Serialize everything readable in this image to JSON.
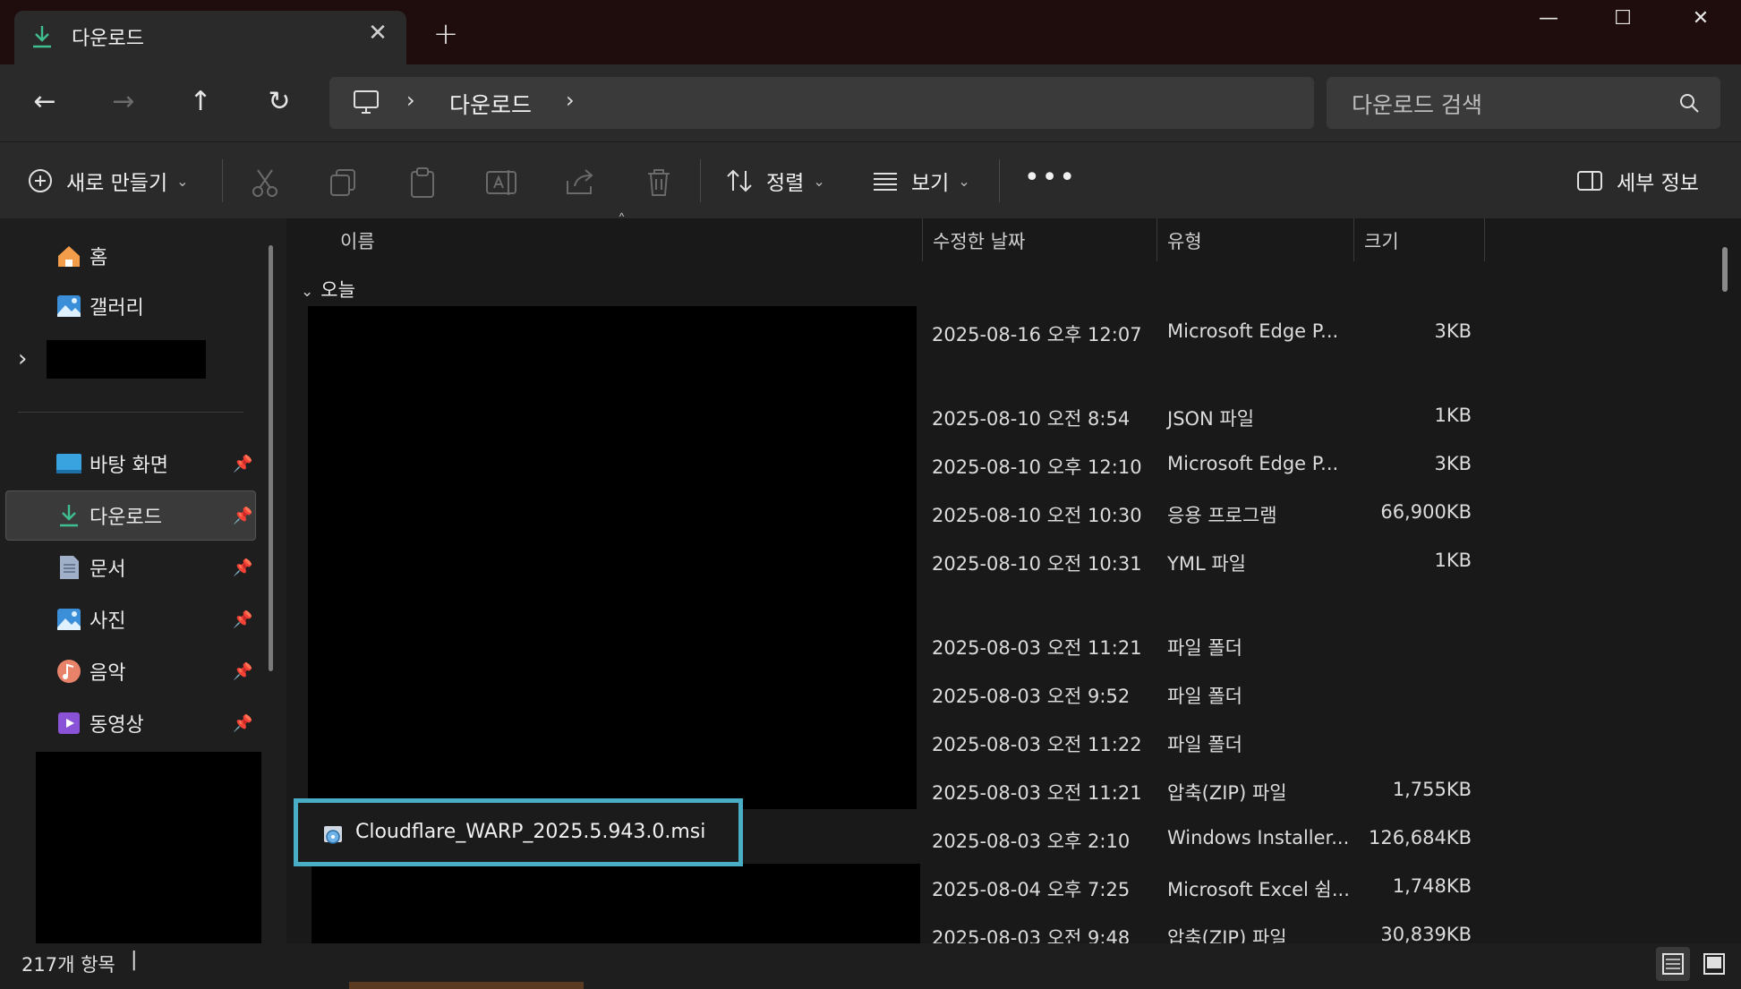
{
  "tab": {
    "title": "다운로드",
    "close": "✕",
    "new": "+"
  },
  "window": {
    "min": "—",
    "max": "☐",
    "close": "✕"
  },
  "nav": {
    "back": "←",
    "forward": "→",
    "up": "↑",
    "refresh": "↻"
  },
  "address": {
    "sep": "›",
    "crumb": "다운로드"
  },
  "search": {
    "placeholder": "다운로드 검색"
  },
  "commands": {
    "new": "새로 만들기",
    "sort": "정렬",
    "view": "보기",
    "more": "•••",
    "details": "세부 정보",
    "chev": "⌄"
  },
  "sidebar": {
    "expand": "›",
    "pin": "📌",
    "items": [
      {
        "label": "홈"
      },
      {
        "label": "갤러리"
      },
      {
        "label": "바탕 화면"
      },
      {
        "label": "다운로드"
      },
      {
        "label": "문서"
      },
      {
        "label": "사진"
      },
      {
        "label": "음악"
      },
      {
        "label": "동영상"
      }
    ]
  },
  "columns": {
    "name": "이름",
    "modified": "수정한 날짜",
    "type": "유형",
    "size": "크기",
    "caret": "˄"
  },
  "group": {
    "today": "오늘",
    "chev": "⌄"
  },
  "rows": [
    {
      "date": "2025-08-16 오후 12:07",
      "type": "Microsoft Edge P...",
      "size": "3KB"
    },
    {
      "date": "2025-08-10 오전 8:54",
      "type": "JSON 파일",
      "size": "1KB"
    },
    {
      "date": "2025-08-10 오후 12:10",
      "type": "Microsoft Edge P...",
      "size": "3KB"
    },
    {
      "date": "2025-08-10 오전 10:30",
      "type": "응용 프로그램",
      "size": "66,900KB"
    },
    {
      "date": "2025-08-10 오전 10:31",
      "type": "YML 파일",
      "size": "1KB"
    },
    {
      "date": "2025-08-03 오전 11:21",
      "type": "파일 폴더",
      "size": ""
    },
    {
      "date": "2025-08-03 오전 9:52",
      "type": "파일 폴더",
      "size": ""
    },
    {
      "date": "2025-08-03 오전 11:22",
      "type": "파일 폴더",
      "size": ""
    },
    {
      "date": "2025-08-03 오전 11:21",
      "type": "압축(ZIP) 파일",
      "size": "1,755KB"
    },
    {
      "name": "Cloudflare_WARP_2025.5.943.0.msi",
      "date": "2025-08-03 오후 2:10",
      "type": "Windows Installer...",
      "size": "126,684KB"
    },
    {
      "date": "2025-08-04 오후 7:25",
      "type": "Microsoft Excel 쉼...",
      "size": "1,748KB"
    },
    {
      "date": "2025-08-03 오전 9:48",
      "type": "압축(ZIP) 파일",
      "size": "30,839KB"
    }
  ],
  "status": {
    "count": "217개 항목",
    "cursor": "|"
  },
  "colors": {
    "accent": "#49aec5",
    "download_green": "#3fbf8f"
  }
}
